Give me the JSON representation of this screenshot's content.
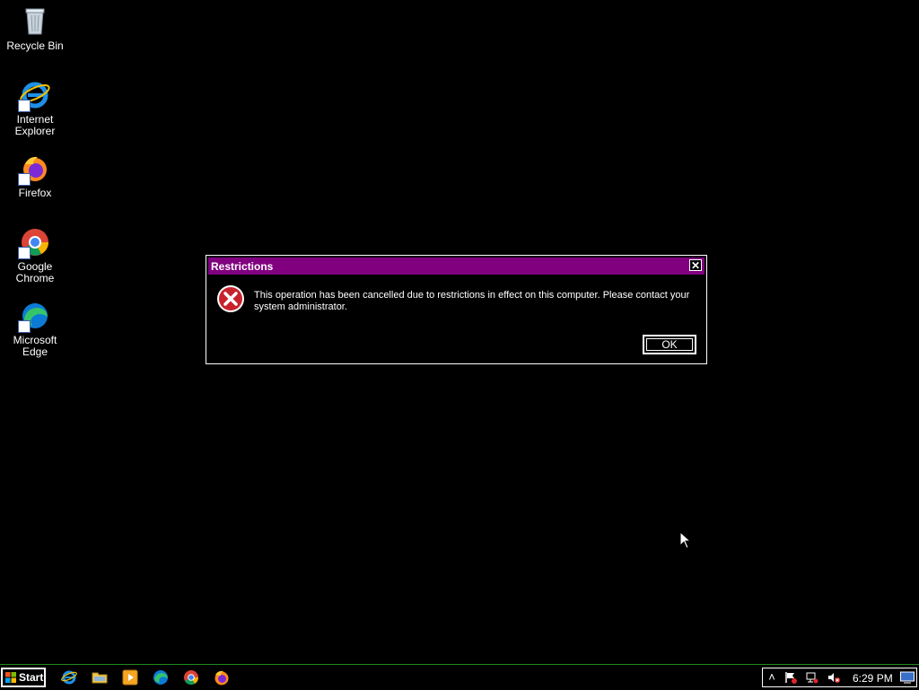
{
  "desktop_icons": [
    {
      "label_line1": "Recycle Bin",
      "label_line2": "",
      "icon": "recycle-bin-icon"
    },
    {
      "label_line1": "Internet",
      "label_line2": "Explorer",
      "icon": "internet-explorer-icon"
    },
    {
      "label_line1": "Firefox",
      "label_line2": "",
      "icon": "firefox-icon"
    },
    {
      "label_line1": "Google",
      "label_line2": "Chrome",
      "icon": "chrome-icon"
    },
    {
      "label_line1": "Microsoft",
      "label_line2": "Edge",
      "icon": "edge-icon"
    }
  ],
  "dialog": {
    "title": "Restrictions",
    "close_glyph": "✕",
    "icon": "error-icon",
    "message": "This operation has been cancelled due to restrictions in effect on this computer. Please contact your system administrator.",
    "ok_label": "OK"
  },
  "taskbar": {
    "start_label": "Start",
    "quick_launch": [
      "internet-explorer-icon",
      "file-explorer-icon",
      "media-player-icon",
      "edge-icon",
      "chrome-icon",
      "firefox-icon"
    ],
    "tray": {
      "expand_glyph": "˄",
      "clock": "6:29 PM"
    }
  },
  "colors": {
    "desktop_bg": "#000000",
    "titlebar": "#800080",
    "taskbar_border": "#1e8a1e"
  }
}
